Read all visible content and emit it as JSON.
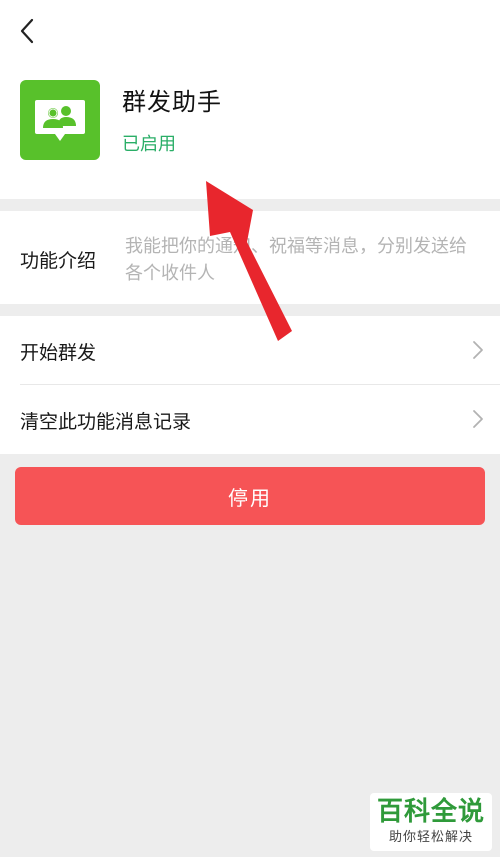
{
  "nav": {
    "back_icon": "chevron-left-icon"
  },
  "app": {
    "icon": "group-message-icon",
    "icon_color": "#58c12b",
    "name": "群发助手",
    "status": "已启用",
    "status_color": "#2aae67"
  },
  "intro": {
    "label": "功能介绍",
    "text": "我能把你的通知、祝福等消息，分别发送给各个收件人"
  },
  "menu": {
    "items": [
      {
        "label": "开始群发",
        "icon": "chevron-right-icon"
      },
      {
        "label": "清空此功能消息记录",
        "icon": "chevron-right-icon"
      }
    ]
  },
  "action": {
    "disable_label": "停用",
    "color": "#f65456"
  },
  "annotation": {
    "icon": "red-arrow",
    "color": "#e8262d"
  },
  "watermark": {
    "title": "百科全说",
    "subtitle": "助你轻松解决"
  }
}
